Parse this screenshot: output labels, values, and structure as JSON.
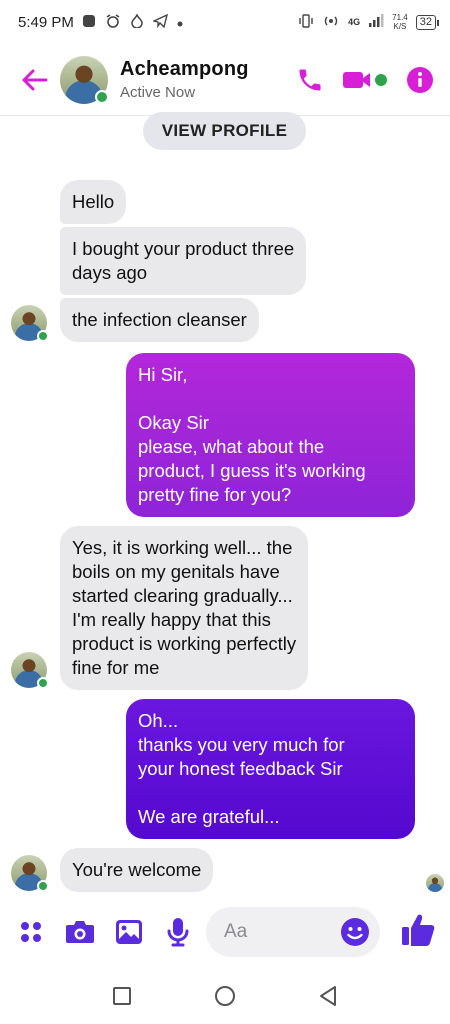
{
  "status_bar": {
    "time": "5:49 PM",
    "network": "4G",
    "speed_value": "71.4",
    "speed_unit": "K/S",
    "battery": "32"
  },
  "header": {
    "contact_name": "Acheampong",
    "contact_status": "Active Now",
    "accent_color": "#d61fd6"
  },
  "chat": {
    "view_profile_label": "VIEW PROFILE",
    "messages": [
      {
        "direction": "in",
        "text": "Hello"
      },
      {
        "direction": "in",
        "text": "I bought your product three\ndays ago"
      },
      {
        "direction": "in",
        "text": "the infection cleanser"
      },
      {
        "direction": "out",
        "text": "Hi Sir,\n\nOkay Sir\nplease, what about the\nproduct, I guess it's working\npretty fine for you?"
      },
      {
        "direction": "in",
        "text": "Yes, it is working well... the\nboils on my genitals have\nstarted clearing gradually...\nI'm really happy that this\nproduct is working perfectly\nfine for me"
      },
      {
        "direction": "out",
        "text": "Oh...\nthanks you very much for\nyour honest feedback Sir\n\nWe are grateful..."
      },
      {
        "direction": "in",
        "text": "You're welcome"
      }
    ]
  },
  "composer": {
    "placeholder": "Aa",
    "accent_color": "#5b2be0",
    "icons": [
      "menu-dots-icon",
      "camera-icon",
      "gallery-icon",
      "microphone-icon",
      "emoji-icon",
      "thumbs-up-icon"
    ]
  },
  "navbar": {
    "icons": [
      "recents-icon",
      "home-icon",
      "back-icon"
    ]
  }
}
